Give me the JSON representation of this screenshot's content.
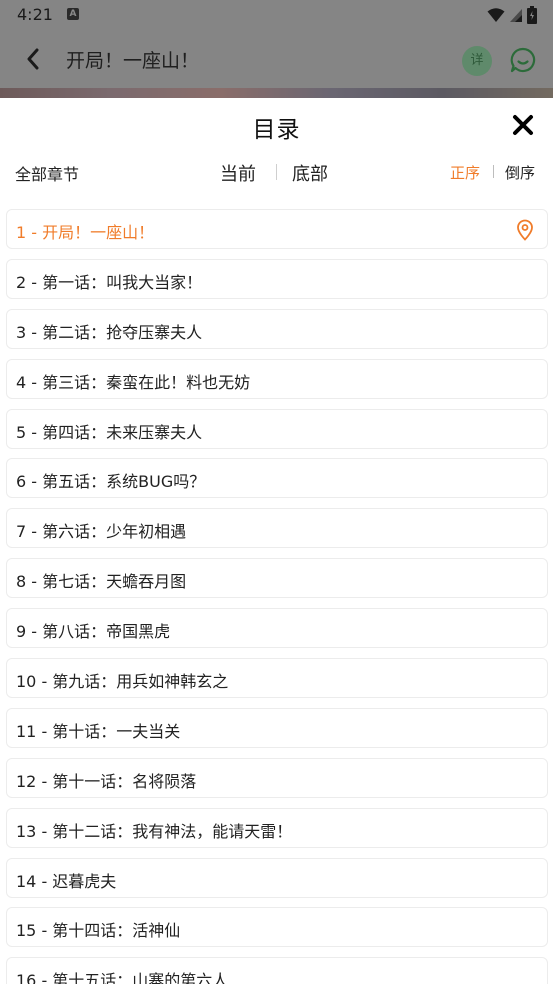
{
  "status_bar": {
    "time": "4:21",
    "notification_badge": "A"
  },
  "app_header": {
    "title": "开局！一座山！",
    "detail_label": "详"
  },
  "sheet": {
    "title": "目录",
    "all_chapters_label": "全部章节",
    "nav_current_label": "当前",
    "nav_bottom_label": "底部",
    "sort_asc_label": "正序",
    "sort_desc_label": "倒序"
  },
  "chapters": [
    {
      "text": "1 - 开局！一座山！",
      "active": true
    },
    {
      "text": "2 - 第一话：叫我大当家！"
    },
    {
      "text": "3 - 第二话：抢夺压寨夫人"
    },
    {
      "text": "4 - 第三话：秦蛮在此！料也无妨"
    },
    {
      "text": "5 - 第四话：未来压寨夫人"
    },
    {
      "text": "6 - 第五话：系统BUG吗？"
    },
    {
      "text": "7 - 第六话：少年初相遇"
    },
    {
      "text": "8 - 第七话：天蟾吞月图"
    },
    {
      "text": "9 - 第八话：帝国黑虎"
    },
    {
      "text": "10 - 第九话：用兵如神韩玄之"
    },
    {
      "text": "11 - 第十话：一夫当关"
    },
    {
      "text": "12 - 第十一话：名将陨落"
    },
    {
      "text": "13 - 第十二话：我有神法，能请天雷！"
    },
    {
      "text": "14 - 迟暮虎夫"
    },
    {
      "text": "15 - 第十四话：活神仙"
    },
    {
      "text": "16 - 第十五话：山寨的第六人"
    }
  ],
  "colors": {
    "accent": "#f07c2a",
    "scrim": "#858585"
  }
}
